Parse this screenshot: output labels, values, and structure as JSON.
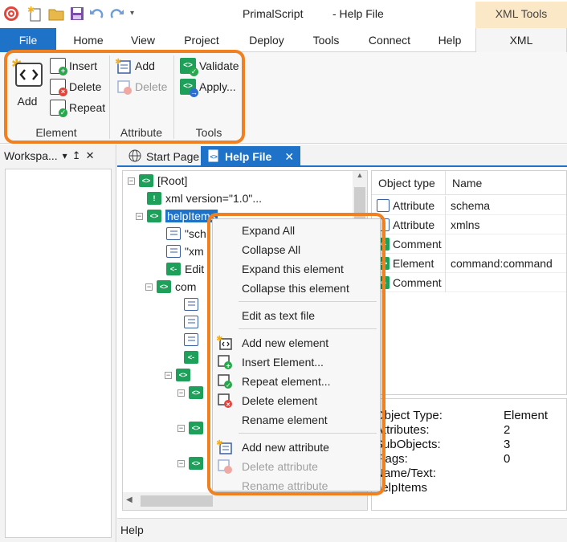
{
  "window": {
    "app_title": "PrimalScript",
    "doc_title": "- Help File",
    "context_group": "XML Tools"
  },
  "tabs": [
    "File",
    "Home",
    "View",
    "Project",
    "Deploy",
    "Tools",
    "Connect",
    "Help",
    "XML"
  ],
  "ribbon": {
    "element_group": {
      "label": "Element",
      "add": "Add",
      "insert": "Insert",
      "delete": "Delete",
      "repeat": "Repeat"
    },
    "attribute_group": {
      "label": "Attribute",
      "add": "Add",
      "delete": "Delete"
    },
    "tools_group": {
      "label": "Tools",
      "validate": "Validate",
      "apply": "Apply..."
    }
  },
  "workspace": {
    "title": "Workspa...",
    "pin": "↥",
    "close": "✕",
    "dropdown": "▾"
  },
  "doc_tabs": [
    {
      "label": "Start Page"
    },
    {
      "label": "Help File",
      "close": "✕"
    }
  ],
  "tree": [
    {
      "label": "[Root]",
      "type": "element",
      "expander": "−"
    },
    {
      "label": "xml version=\"1.0\"...",
      "type": "pi"
    },
    {
      "label": "helpItems",
      "type": "element",
      "expander": "−",
      "selected": true
    },
    {
      "label": "\"sch",
      "type": "attr"
    },
    {
      "label": "\"xm",
      "type": "attr"
    },
    {
      "label": "Edit",
      "type": "comment"
    },
    {
      "label": "com",
      "type": "element",
      "expander": "−"
    },
    {
      "label": "",
      "type": "attr"
    },
    {
      "label": "",
      "type": "attr"
    },
    {
      "label": "",
      "type": "attr"
    },
    {
      "label": "",
      "type": "comment"
    },
    {
      "label": "",
      "type": "element",
      "expander": "−"
    },
    {
      "label": "",
      "type": "element",
      "expander": "−"
    },
    {
      "label": "",
      "type": "element",
      "expander": "−"
    },
    {
      "label": "",
      "type": "element",
      "expander": "−"
    }
  ],
  "grid": {
    "headers": [
      "Object type",
      "Name"
    ],
    "rows": [
      {
        "type": "Attribute",
        "name": "schema",
        "kind": "attr"
      },
      {
        "type": "Attribute",
        "name": "xmlns",
        "kind": "attr"
      },
      {
        "type": "Comment",
        "name": "",
        "kind": "comment"
      },
      {
        "type": "Element",
        "name": "command:command",
        "kind": "element"
      },
      {
        "type": "Comment",
        "name": "",
        "kind": "comment"
      }
    ]
  },
  "properties": [
    {
      "key": "Object Type:",
      "value": "Element"
    },
    {
      "key": "Attributes:",
      "value": "2"
    },
    {
      "key": "SubObjects:",
      "value": "3"
    },
    {
      "key": "Flags:",
      "value": "0"
    },
    {
      "key": "Name/Text:",
      "value": ""
    },
    {
      "key": "helpItems",
      "value": ""
    }
  ],
  "context_menu": [
    {
      "label": "Expand All",
      "icon": ""
    },
    {
      "label": "Collapse All",
      "icon": ""
    },
    {
      "label": "Expand this element",
      "icon": ""
    },
    {
      "label": "Collapse this element",
      "icon": ""
    },
    {
      "separator": true
    },
    {
      "label": "Edit as text file",
      "icon": ""
    },
    {
      "separator": true
    },
    {
      "label": "Add new element",
      "icon": "add-element-icon"
    },
    {
      "label": "Insert Element...",
      "icon": "insert-element-icon"
    },
    {
      "label": "Repeat element...",
      "icon": "repeat-element-icon"
    },
    {
      "label": "Delete element",
      "icon": "delete-element-icon"
    },
    {
      "label": "Rename element",
      "icon": ""
    },
    {
      "separator": true
    },
    {
      "label": "Add new attribute",
      "icon": "add-attribute-icon"
    },
    {
      "label": "Delete attribute",
      "icon": "delete-attribute-icon",
      "disabled": true
    },
    {
      "label": "Rename attribute",
      "icon": "",
      "disabled": true
    }
  ],
  "status": {
    "text": "Help"
  },
  "colors": {
    "accent": "#1e72c8",
    "highlight": "#f08020",
    "context_tab": "#fbe8c7",
    "element_green": "#1fa05a"
  }
}
